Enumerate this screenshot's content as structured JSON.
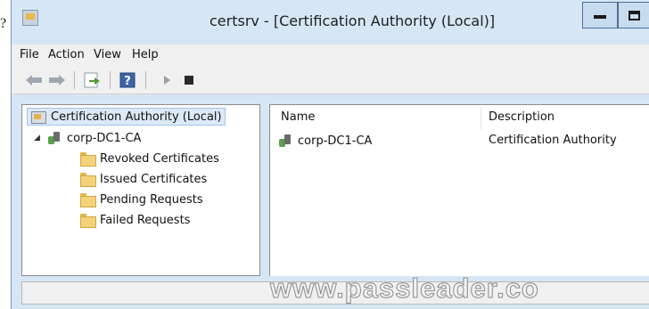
{
  "stray_char": "?",
  "window": {
    "title": "certsrv - [Certification Authority (Local)]"
  },
  "menu": {
    "items": [
      "File",
      "Action",
      "View",
      "Help"
    ]
  },
  "toolbar": {
    "icons": [
      "back-arrow-icon",
      "forward-arrow-icon",
      "export-list-icon",
      "help-icon",
      "start-service-icon",
      "stop-service-icon"
    ]
  },
  "tree": {
    "root": "Certification Authority (Local)",
    "ca": "corp-DC1-CA",
    "folders": [
      "Revoked Certificates",
      "Issued Certificates",
      "Pending Requests",
      "Failed Requests"
    ]
  },
  "list": {
    "columns": [
      "Name",
      "Description"
    ],
    "rows": [
      {
        "name": "corp-DC1-CA",
        "description": "Certification Authority"
      }
    ]
  },
  "watermark": "www.passleader.co",
  "colors": {
    "title_bar": "#d6e6f5",
    "selection": "#dce9f6",
    "folder": "#f3d27a"
  }
}
